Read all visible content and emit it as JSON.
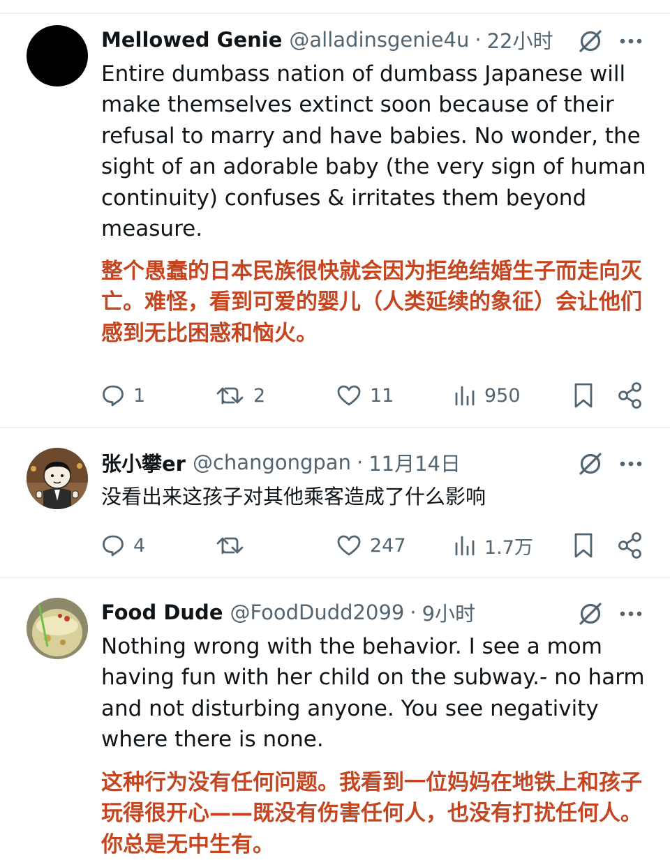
{
  "tweets": [
    {
      "name": "Mellowed Genie",
      "handle": "@alladinsgenie4u",
      "time": "22小时",
      "text_en": "Entire dumbass nation of dumbass Japanese will make themselves extinct soon because of their refusal to marry and have babies. No wonder, the sight of an adorable baby (the very sign of human continuity) confuses & irritates them beyond measure.",
      "text_zh": "整个愚蠢的日本民族很快就会因为拒绝结婚生子而走向灭亡。难怪，看到可爱的婴儿（人类延续的象征）会让他们感到无比困惑和恼火。",
      "replies": "1",
      "reposts": "2",
      "likes": "11",
      "views": "950"
    },
    {
      "name": "张小攀er",
      "handle": "@changongpan",
      "time": "11月14日",
      "text": "没看出来这孩子对其他乘客造成了什么影响",
      "replies": "4",
      "reposts": "",
      "likes": "247",
      "views": "1.7万"
    },
    {
      "name": "Food Dude",
      "handle": "@FoodDudd2099",
      "time": "9小时",
      "text_en": "Nothing wrong with the behavior.  I see a mom having fun with her child on the subway.- no harm and not disturbing anyone.  You see negativity where there is none.",
      "text_zh": "这种行为没有任何问题。我看到一位妈妈在地铁上和孩子玩得很开心——既没有伤害任何人，也没有打扰任何人。你总是无中生有。"
    }
  ],
  "separator": "·",
  "colors": {
    "text": "#0f1419",
    "secondary": "#536471",
    "translation": "#c4451f",
    "divider": "#eff3f4"
  },
  "icons": [
    "grok-icon",
    "more-icon",
    "reply-icon",
    "repost-icon",
    "like-icon",
    "views-icon",
    "bookmark-icon",
    "share-icon"
  ]
}
